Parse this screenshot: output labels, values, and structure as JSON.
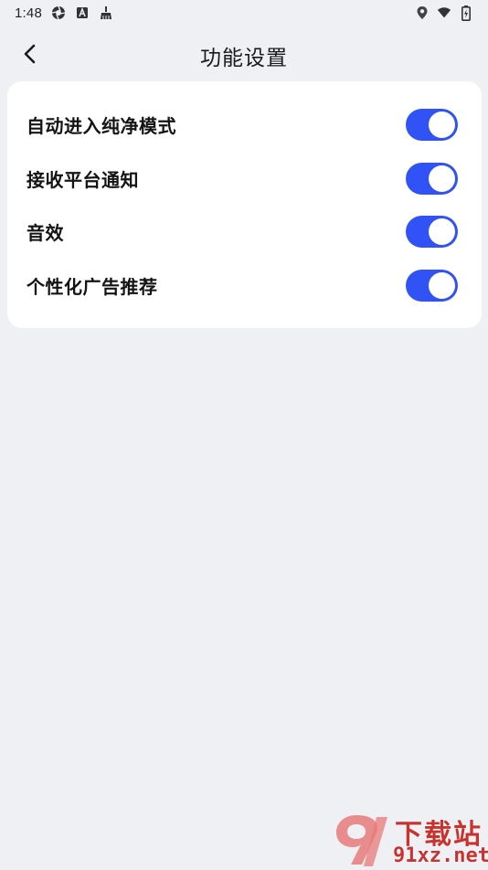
{
  "status_bar": {
    "time": "1:48",
    "left_icons": [
      "aperture-icon",
      "a-square-icon",
      "broom-icon"
    ],
    "right_icons": [
      "location-icon",
      "wifi-icon",
      "battery-charging-icon"
    ]
  },
  "header": {
    "title": "功能设置",
    "back_icon": "chevron-left-icon"
  },
  "settings": {
    "items": [
      {
        "label": "自动进入纯净模式",
        "enabled": true
      },
      {
        "label": "接收平台通知",
        "enabled": true
      },
      {
        "label": "音效",
        "enabled": true
      },
      {
        "label": "个性化广告推荐",
        "enabled": true
      }
    ]
  },
  "colors": {
    "background": "#eff0f4",
    "card": "#ffffff",
    "toggle_on": "#3153f5",
    "watermark": "#c9322f"
  },
  "watermark": {
    "title": "下载站",
    "site": "91xz.net"
  }
}
